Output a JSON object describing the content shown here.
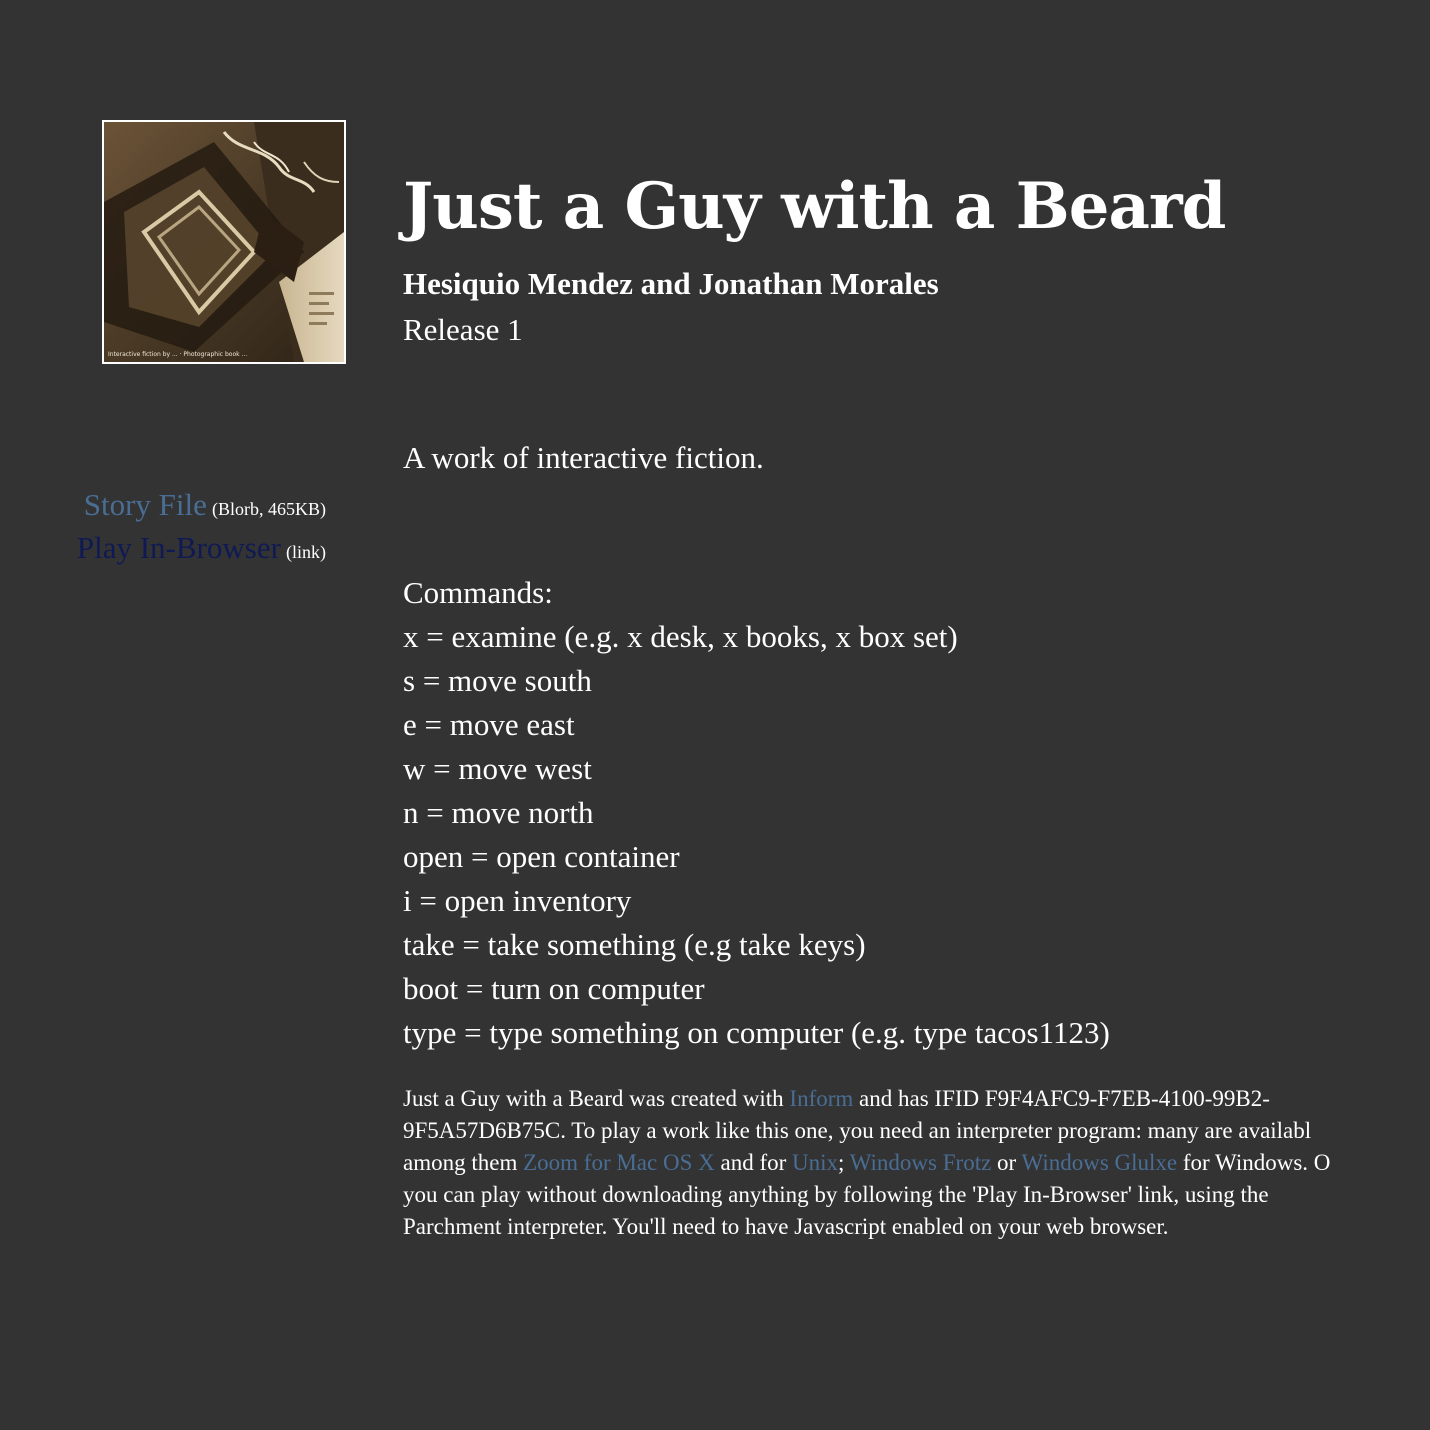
{
  "title": "Just a Guy with a Beard",
  "author": "Hesiquio Mendez and Jonathan Morales",
  "release": "Release 1",
  "blurb": "A work of interactive fiction.",
  "cover": {
    "caption": "Interactive fiction by ... · Photographic book ..."
  },
  "downloads": {
    "story_file_label": "Story File",
    "story_file_meta": "(Blorb, 465KB)",
    "play_label": "Play In-Browser",
    "play_meta": "(link)"
  },
  "commands": {
    "heading": "Commands:",
    "items": [
      "x = examine (e.g. x desk, x books, x box set)",
      "s = move south",
      "e = move east",
      "w = move west",
      "n = move north",
      "open = open container",
      "i = open inventory",
      "take = take something (e.g take keys)",
      "boot = turn on computer",
      "type = type something on computer (e.g. type tacos1123)"
    ]
  },
  "fine_print": {
    "line1_pre": "Just a Guy with a Beard was created with ",
    "inform_link": "Inform",
    "line1_post": " and has IFID F9F4AFC9-F7EB-4100-99B2-",
    "line2": "9F5A57D6B75C. To play a work like this one, you need an interpreter program: many are availabl",
    "line3_pre": "among them ",
    "zoom_link": "Zoom for Mac OS X",
    "line3_mid1": " and for ",
    "unix_link": "Unix",
    "line3_mid2": "; ",
    "frotz_link": "Windows Frotz",
    "line3_mid3": " or ",
    "glulxe_link": "Windows Glulxe",
    "line3_post": " for Windows. O",
    "line4": "you can play without downloading anything by following the 'Play In-Browser' link, using the",
    "line5": "Parchment interpreter. You'll need to have Javascript enabled on your web browser."
  },
  "colors": {
    "background": "#333333",
    "text": "#ffffff",
    "link": "#4a6d94",
    "visited_link": "#0f1a55"
  }
}
